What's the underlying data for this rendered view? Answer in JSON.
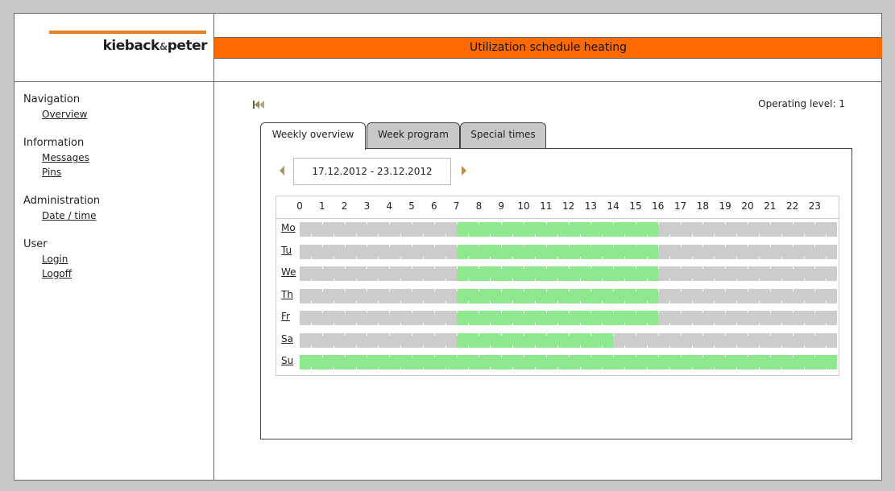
{
  "logo": {
    "text_left": "kieback",
    "text_amp": "&",
    "text_right": "peter"
  },
  "header": {
    "title": "Utilization schedule heating"
  },
  "nav": [
    {
      "heading": "Navigation",
      "links": [
        "Overview"
      ]
    },
    {
      "heading": "Information",
      "links": [
        "Messages",
        "Pins"
      ]
    },
    {
      "heading": "Administration",
      "links": [
        "Date / time"
      ]
    },
    {
      "heading": "User",
      "links": [
        "Login",
        "Logoff"
      ]
    }
  ],
  "operating_level": "Operating level: 1",
  "tabs": [
    "Weekly overview",
    "Week program",
    "Special times"
  ],
  "active_tab": "Weekly overview",
  "date_range": "17.12.2012 - 23.12.2012",
  "hours": [
    "0",
    "1",
    "2",
    "3",
    "4",
    "5",
    "6",
    "7",
    "8",
    "9",
    "10",
    "11",
    "12",
    "13",
    "14",
    "15",
    "16",
    "17",
    "18",
    "19",
    "20",
    "21",
    "22",
    "23"
  ],
  "colors": {
    "on": "#8ee88e",
    "off": "#cccccc",
    "accent": "#ff6a00"
  },
  "schedule": [
    {
      "day": "Mo",
      "on": [
        [
          7,
          16
        ]
      ]
    },
    {
      "day": "Tu",
      "on": [
        [
          7,
          16
        ]
      ]
    },
    {
      "day": "We",
      "on": [
        [
          7,
          16
        ]
      ]
    },
    {
      "day": "Th",
      "on": [
        [
          7,
          16
        ]
      ]
    },
    {
      "day": "Fr",
      "on": [
        [
          7,
          16
        ]
      ]
    },
    {
      "day": "Sa",
      "on": [
        [
          7,
          14
        ]
      ]
    },
    {
      "day": "Su",
      "on": [
        [
          0,
          24
        ]
      ]
    }
  ]
}
